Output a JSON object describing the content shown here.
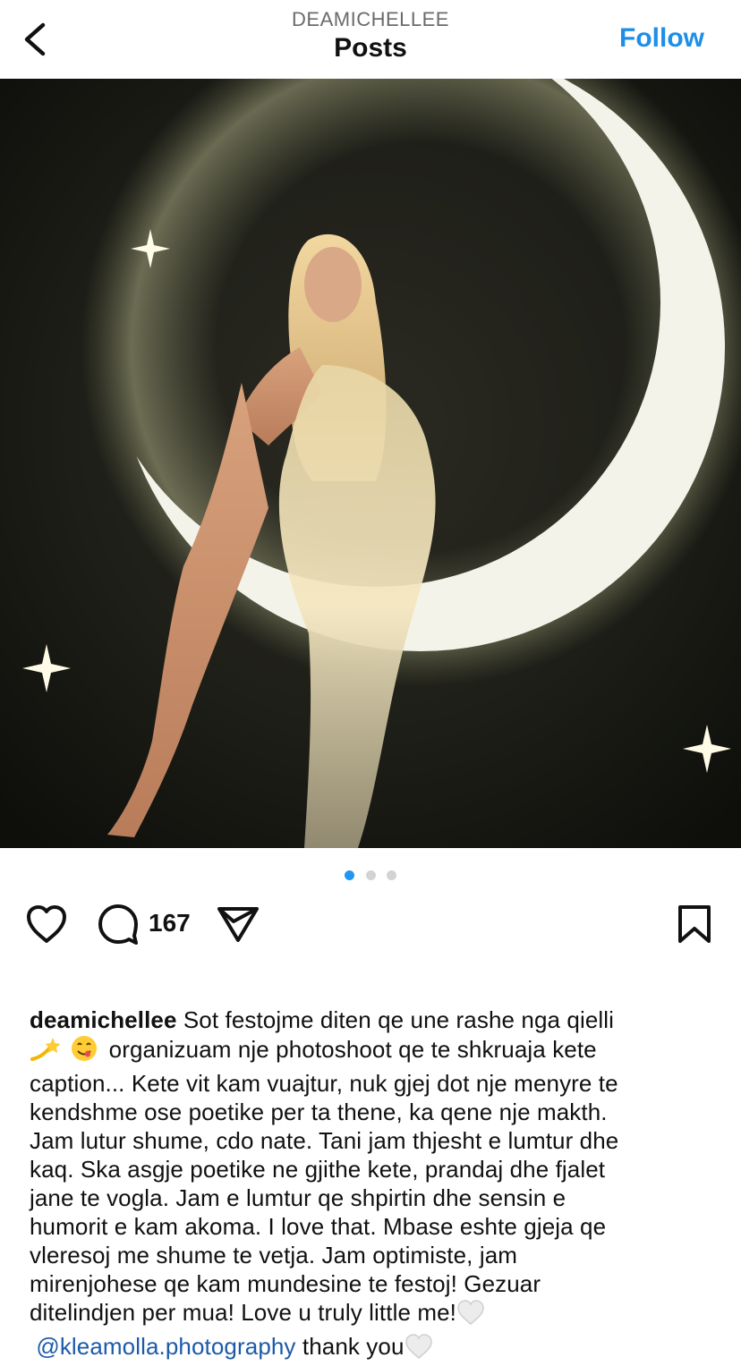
{
  "header": {
    "username": "DEAMICHELLEE",
    "title": "Posts",
    "follow_label": "Follow"
  },
  "carousel": {
    "count": 3,
    "active_index": 0
  },
  "actions": {
    "comment_count": "167"
  },
  "caption": {
    "username": "deamichellee",
    "line1": "Sot festojme diten qe une rashe nga qielli",
    "line2": "organizuam nje photoshoot qe te shkruaja kete",
    "line3": "caption... Kete vit kam vuajtur,  nuk gjej dot nje menyre te",
    "line4": "kendshme ose poetike per ta thene, ka qene nje makth.",
    "line5": "Jam lutur shume, cdo nate. Tani jam thjesht e lumtur dhe",
    "line6": "kaq. Ska asgje poetike ne gjithe kete, prandaj dhe fjalet",
    "line7": "jane te vogla. Jam e lumtur qe shpirtin dhe sensin e",
    "line8": "humorit e kam akoma. I love that. Mbase eshte gjeja qe",
    "line9": "vleresoj me shume te vetja. Jam optimiste, jam",
    "line10": "mirenjohese qe kam mundesine te festoj! Gezuar",
    "line11": "ditelindjen per mua! Love u truly little me!",
    "mention": "@kleamolla.photography",
    "thanks": "thank you"
  },
  "icons": [
    "back-chevron-icon",
    "heart-icon",
    "comment-icon",
    "share-icon",
    "bookmark-icon",
    "dizzy-emoji-icon",
    "yum-emoji-icon",
    "white-heart-icon"
  ],
  "colors": {
    "accent": "#1e8fe8",
    "mention": "#1c5aa8",
    "dot_active": "#2196f3",
    "dot_inactive": "#d3d3d3"
  }
}
